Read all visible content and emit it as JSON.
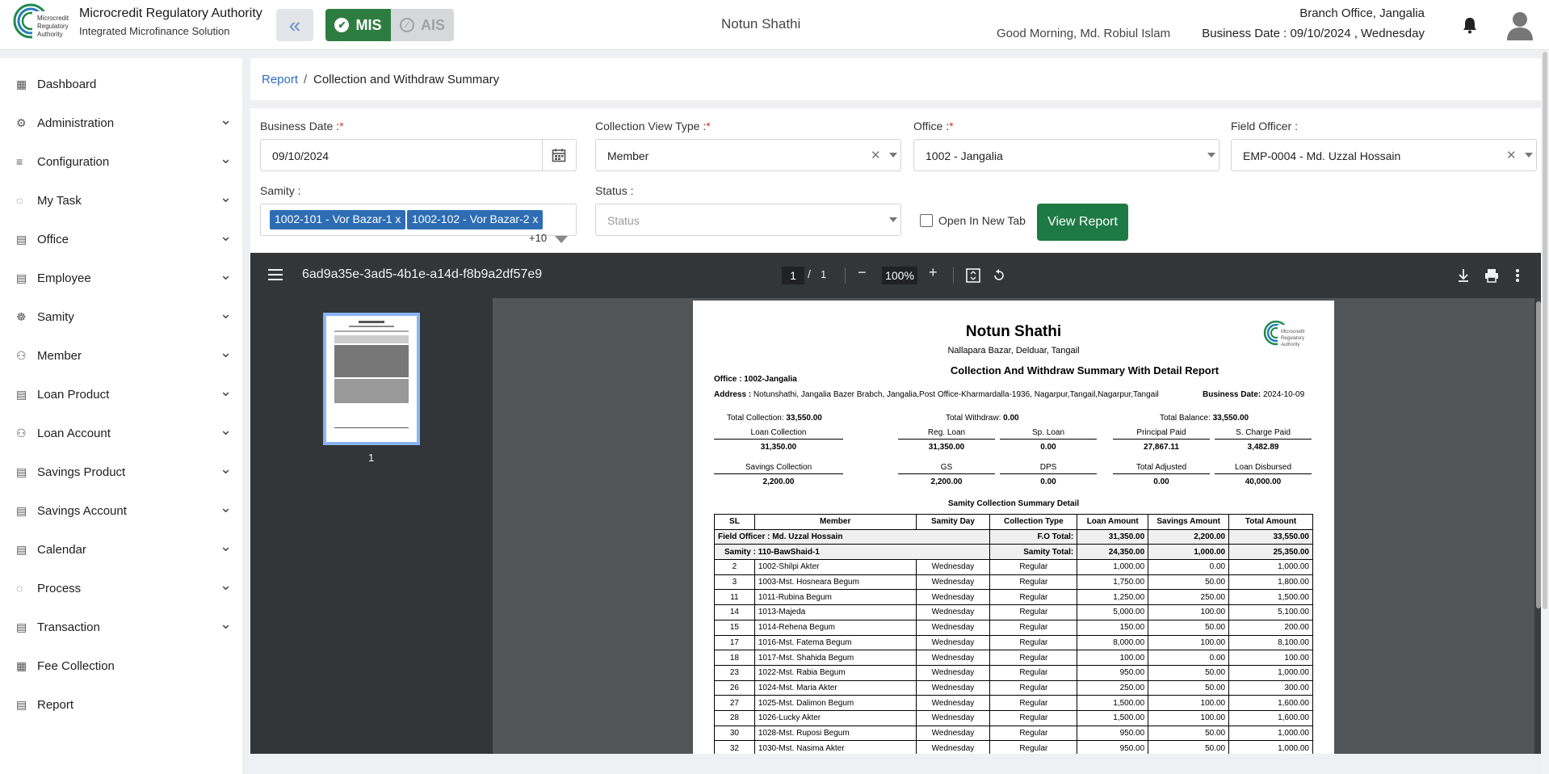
{
  "header": {
    "org_name": "Microcredit Regulatory Authority",
    "org_sub": "Integrated Microfinance Solution",
    "logo_text": "Microcredit Regulatory Authority",
    "mis_label": "MIS",
    "ais_label": "AIS",
    "center_title": "Notun Shathi",
    "greeting": "Good Morning, Md. Robiul Islam",
    "branch": "Branch Office, Jangalia",
    "business_date": "Business Date : 09/10/2024 , Wednesday"
  },
  "sidebar": {
    "items": [
      {
        "label": "Dashboard",
        "icon": "dashboard-icon",
        "expandable": false
      },
      {
        "label": "Administration",
        "icon": "admin-icon",
        "expandable": true
      },
      {
        "label": "Configuration",
        "icon": "sliders-icon",
        "expandable": true
      },
      {
        "label": "My Task",
        "icon": "task-icon",
        "expandable": true
      },
      {
        "label": "Office",
        "icon": "office-icon",
        "expandable": true
      },
      {
        "label": "Employee",
        "icon": "employee-icon",
        "expandable": true
      },
      {
        "label": "Samity",
        "icon": "samity-icon",
        "expandable": true
      },
      {
        "label": "Member",
        "icon": "member-icon",
        "expandable": true
      },
      {
        "label": "Loan Product",
        "icon": "loan-product-icon",
        "expandable": true
      },
      {
        "label": "Loan Account",
        "icon": "loan-account-icon",
        "expandable": true
      },
      {
        "label": "Savings Product",
        "icon": "savings-product-icon",
        "expandable": true
      },
      {
        "label": "Savings Account",
        "icon": "savings-account-icon",
        "expandable": true
      },
      {
        "label": "Calendar",
        "icon": "calendar-icon",
        "expandable": true
      },
      {
        "label": "Process",
        "icon": "process-icon",
        "expandable": true
      },
      {
        "label": "Transaction",
        "icon": "transaction-icon",
        "expandable": true
      },
      {
        "label": "Fee Collection",
        "icon": "fee-icon",
        "expandable": false
      },
      {
        "label": "Report",
        "icon": "report-icon",
        "expandable": false
      }
    ]
  },
  "breadcrumb": {
    "link": "Report",
    "sep": "/",
    "current": "Collection and Withdraw Summary"
  },
  "filters": {
    "business_date_label": "Business Date :",
    "business_date_value": "09/10/2024",
    "view_type_label": "Collection View Type :",
    "view_type_value": "Member",
    "office_label": "Office :",
    "office_value": "1002 - Jangalia",
    "field_officer_label": "Field Officer :",
    "field_officer_value": "EMP-0004 - Md. Uzzal Hossain",
    "samity_label": "Samity :",
    "samity_chips": [
      "1002-101 - Vor Bazar-1",
      "1002-102 - Vor Bazar-2"
    ],
    "chip_remove": "x",
    "samity_more": "+10",
    "status_label": "Status :",
    "status_placeholder": "Status",
    "required_mark": "*",
    "open_new_tab_label": "Open In New Tab",
    "open_new_tab_checked": false,
    "view_report_label": "View Report"
  },
  "pdf_viewer": {
    "file_name": "6ad9a35e-3ad5-4b1e-a14d-f8b9a2df57e9",
    "current_page": "1",
    "page_sep": "/",
    "total_pages": "1",
    "zoom": "100%",
    "thumb_label": "1"
  },
  "report": {
    "org": "Notun Shathi",
    "address_line": "Nallapara Bazar, Delduar, Tangail",
    "title": "Collection And Withdraw Summary With Detail Report",
    "office": "Office : 1002-Jangalia",
    "address_label": "Address :",
    "address": "Notunshathi, Jangalia Bazer Brabch, Jangalia,Post Office-Kharmardalla-1936, Nagarpur,Tangail,Nagarpur,Tangail",
    "business_date_label": "Business Date:",
    "business_date": "2024-10-09",
    "total_collection_label": "Total Collection:",
    "total_collection": "33,550.00",
    "total_withdraw_label": "Total Withdraw:",
    "total_withdraw": "0.00",
    "total_balance_label": "Total Balance:",
    "total_balance": "33,550.00",
    "summary": [
      {
        "label": "Loan Collection",
        "value": "31,350.00"
      },
      {
        "label": "Reg. Loan",
        "value": "31,350.00"
      },
      {
        "label": "Sp. Loan",
        "value": "0.00"
      },
      {
        "label": "Principal Paid",
        "value": "27,867.11"
      },
      {
        "label": "S. Charge Paid",
        "value": "3,482.89"
      },
      {
        "label": "Savings Collection",
        "value": "2,200.00"
      },
      {
        "label": "GS",
        "value": "2,200.00"
      },
      {
        "label": "DPS",
        "value": "0.00"
      },
      {
        "label": "Total Adjusted",
        "value": "0.00"
      },
      {
        "label": "Loan Disbursed",
        "value": "40,000.00"
      }
    ],
    "detail_title": "Samity Collection Summary Detail",
    "columns": [
      "SL",
      "Member",
      "Samity Day",
      "Collection Type",
      "Loan Amount",
      "Savings Amount",
      "Total Amount"
    ],
    "fo_row": {
      "label": "Field Officer : Md. Uzzal Hossain",
      "total_label": "F.O Total:",
      "loan": "31,350.00",
      "savings": "2,200.00",
      "total": "33,550.00"
    },
    "samity_row": {
      "label": "Samity : 110-BawShaid-1",
      "total_label": "Samity Total:",
      "loan": "24,350.00",
      "savings": "1,000.00",
      "total": "25,350.00"
    },
    "rows": [
      [
        "2",
        "1002-Shilpi Akter",
        "Wednesday",
        "Regular",
        "1,000.00",
        "0.00",
        "1,000.00"
      ],
      [
        "3",
        "1003-Mst. Hosneara Begum",
        "Wednesday",
        "Regular",
        "1,750.00",
        "50.00",
        "1,800.00"
      ],
      [
        "11",
        "1011-Rubina Begum",
        "Wednesday",
        "Regular",
        "1,250.00",
        "250.00",
        "1,500.00"
      ],
      [
        "14",
        "1013-Majeda",
        "Wednesday",
        "Regular",
        "5,000.00",
        "100.00",
        "5,100.00"
      ],
      [
        "15",
        "1014-Rehena Begum",
        "Wednesday",
        "Regular",
        "150.00",
        "50.00",
        "200.00"
      ],
      [
        "17",
        "1016-Mst. Fatema Begum",
        "Wednesday",
        "Regular",
        "8,000.00",
        "100.00",
        "8,100.00"
      ],
      [
        "18",
        "1017-Mst. Shahida Begum",
        "Wednesday",
        "Regular",
        "100.00",
        "0.00",
        "100.00"
      ],
      [
        "23",
        "1022-Mst. Rabia Begum",
        "Wednesday",
        "Regular",
        "950.00",
        "50.00",
        "1,000.00"
      ],
      [
        "26",
        "1024-Mst. Maria Akter",
        "Wednesday",
        "Regular",
        "250.00",
        "50.00",
        "300.00"
      ],
      [
        "27",
        "1025-Mst. Dalimon Begum",
        "Wednesday",
        "Regular",
        "1,500.00",
        "100.00",
        "1,600.00"
      ],
      [
        "28",
        "1026-Lucky Akter",
        "Wednesday",
        "Regular",
        "1,500.00",
        "100.00",
        "1,600.00"
      ],
      [
        "30",
        "1028-Mst. Ruposi Begum",
        "Wednesday",
        "Regular",
        "950.00",
        "50.00",
        "1,000.00"
      ],
      [
        "32",
        "1030-Mst. Nasima Akter",
        "Wednesday",
        "Regular",
        "950.00",
        "50.00",
        "1,000.00"
      ]
    ]
  },
  "colors": {
    "brand_green": "#2e7d40",
    "link_blue": "#2d6fc1",
    "chip_blue": "#2e6db4",
    "toolbar_dark": "#323639"
  }
}
